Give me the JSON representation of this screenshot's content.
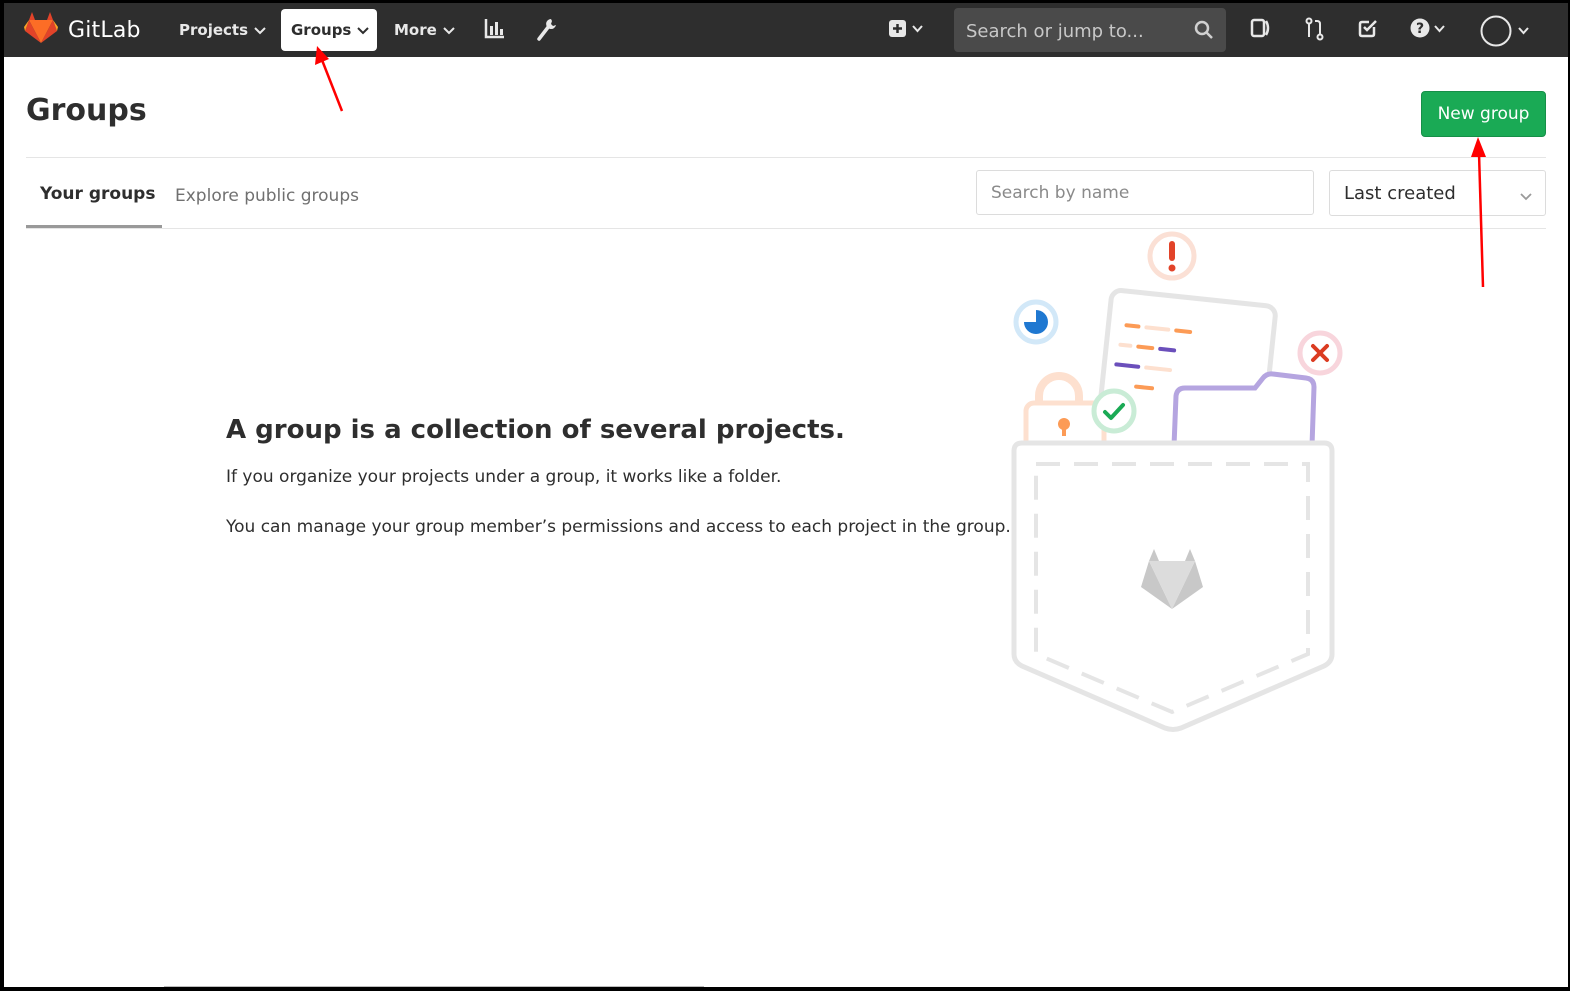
{
  "navbar": {
    "brand": "GitLab",
    "items": [
      {
        "label": "Projects"
      },
      {
        "label": "Groups"
      },
      {
        "label": "More"
      }
    ],
    "search_placeholder": "Search or jump to..."
  },
  "header": {
    "title": "Groups",
    "new_group_label": "New group"
  },
  "tabs": [
    {
      "label": "Your groups"
    },
    {
      "label": "Explore public groups"
    }
  ],
  "filter": {
    "search_placeholder": "Search by name",
    "sort_selected": "Last created"
  },
  "empty_state": {
    "title": "A group is a collection of several projects.",
    "p1": "If you organize your projects under a group, it works like a folder.",
    "p2": "You can manage your group member’s permissions and access to each project in the group."
  },
  "colors": {
    "navbar": "#2e2e2e",
    "primary_green": "#1aaa55",
    "annotation_red": "#ff0000"
  },
  "icons": [
    "gitlab-logo-icon",
    "chevron-down-icon",
    "activity-chart-icon",
    "admin-wrench-icon",
    "plus-square-icon",
    "search-icon",
    "sidebar-toggle-icon",
    "merge-request-icon",
    "todo-icon",
    "help-icon",
    "avatar-icon"
  ]
}
